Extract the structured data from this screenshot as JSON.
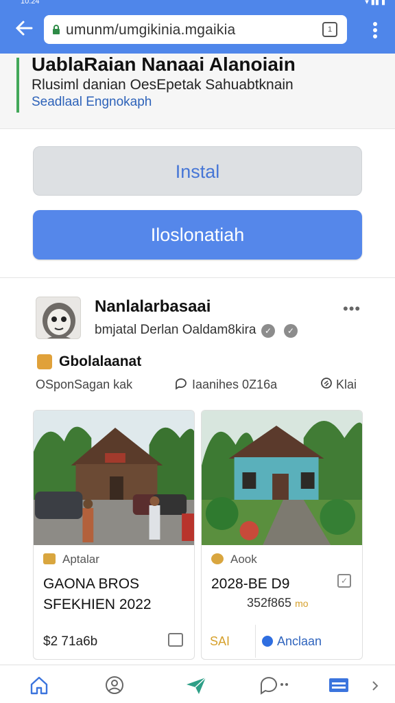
{
  "status_bar": {
    "time": "10:24"
  },
  "browser": {
    "url": "umunm/umgikinia.mgaikia",
    "tab_count": "1"
  },
  "header": {
    "title": "UablaRaian Nanaai Alanoiain",
    "subtitle": "Rlusiml danian OesEpetak Sahuabtknain",
    "link": "Seadlaal Engnokaph"
  },
  "buttons": {
    "install": "Instal",
    "primary": "Iloslonatiah"
  },
  "profile": {
    "name": "Nanlalarbasaai",
    "description": "bmjatal Derlan Oaldam8kira"
  },
  "section": {
    "title": "Gbolalaanat",
    "meta_left": "OSponSagan kak",
    "meta_mid": "Iaanihes 0Z16a",
    "meta_right": "Klai"
  },
  "cards": [
    {
      "category": "Aptalar",
      "title": "GAONA BROS SFEKHIEN 2022",
      "price": "$2 71a6b"
    },
    {
      "category": "Aook",
      "title": "2028-BE D9",
      "amount": "352f865",
      "amount_unit": "mo",
      "sale_label": "SAI",
      "action_label": "Anclaan"
    }
  ],
  "colors": {
    "app_bar": "#4f86ea",
    "accent_green": "#43a85a",
    "link_blue": "#2d62b9",
    "sale_gold": "#d6a02b"
  }
}
